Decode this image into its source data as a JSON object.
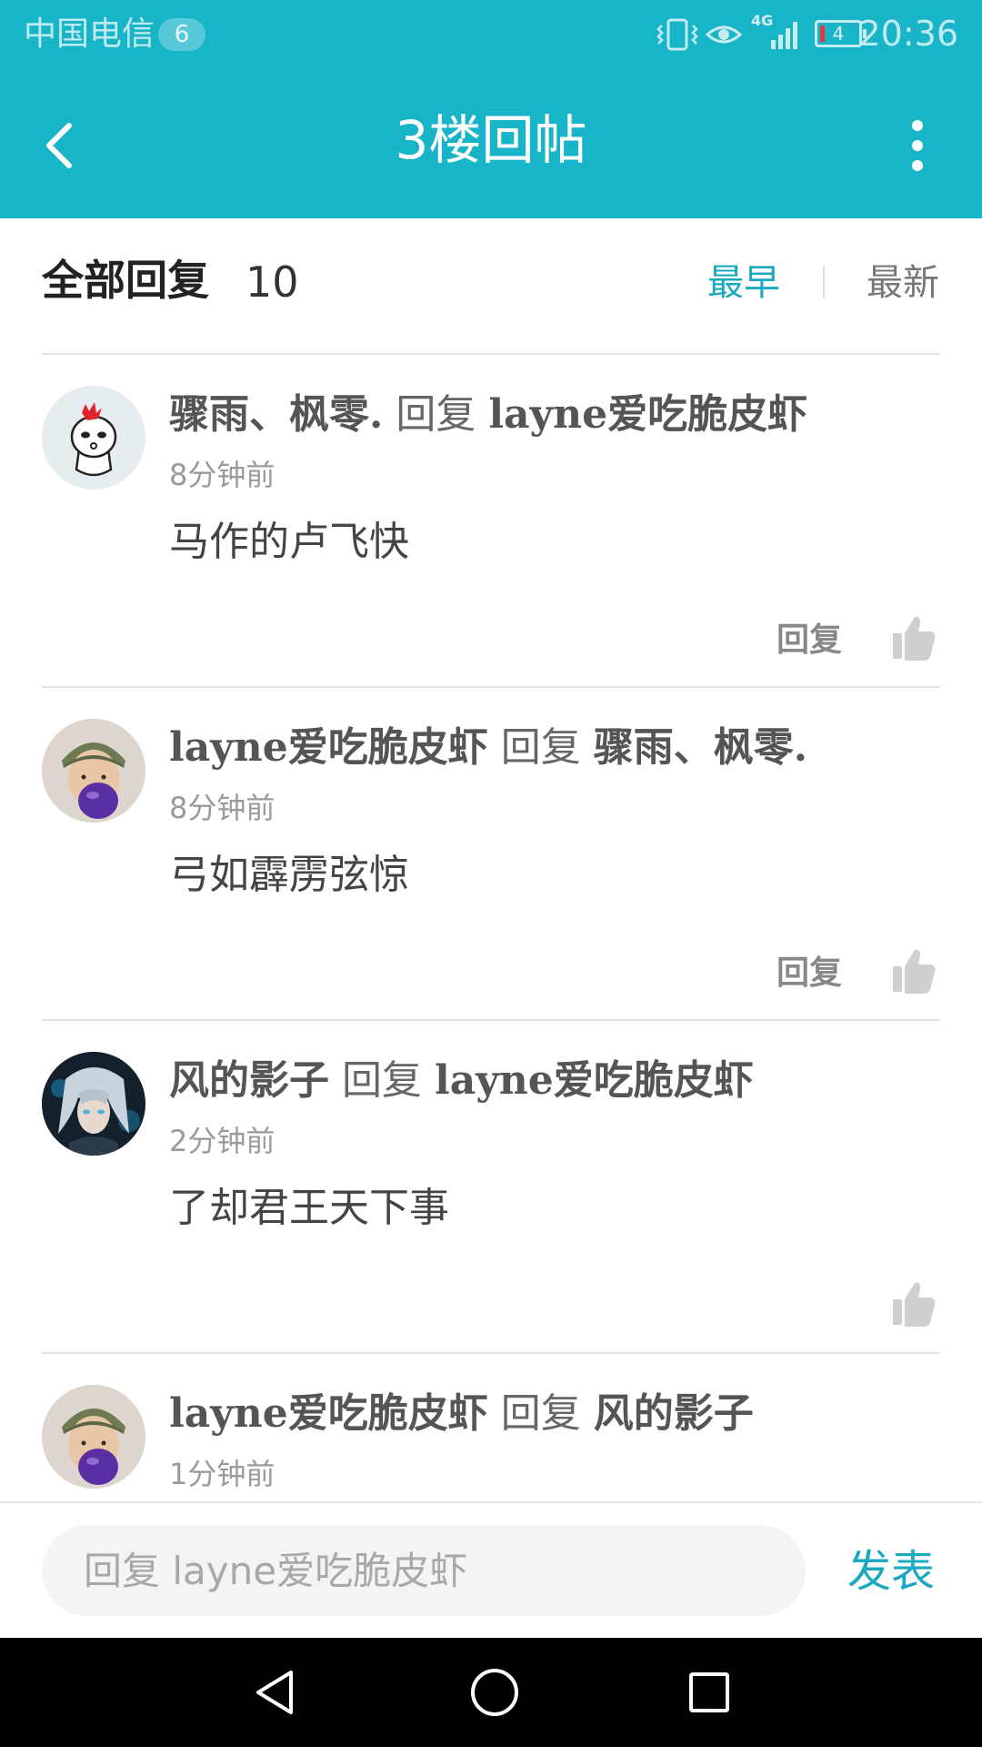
{
  "status_bar": {
    "carrier": "中国电信",
    "sim_badge": "6",
    "network": "4G",
    "battery": "4",
    "time": "20:36"
  },
  "app_bar": {
    "title": "3楼回帖",
    "back_icon": "chevron-left-icon",
    "more_icon": "more-vertical-icon"
  },
  "sort_bar": {
    "title": "全部回复",
    "count": "10",
    "earliest": "最早",
    "newest": "最新",
    "active": "最早",
    "active_color": "#1aa9c0"
  },
  "replies": [
    {
      "author": "骤雨、枫零.",
      "verb": "回复",
      "target": "layne爱吃脆皮虾",
      "time": "8分钟前",
      "text": "马作的卢飞快",
      "action": "回复",
      "avatar": "cartoon-avatar"
    },
    {
      "author": "layne爱吃脆皮虾",
      "verb": "回复",
      "target": "骤雨、枫零.",
      "time": "8分钟前",
      "text": "弓如霹雳弦惊",
      "action": "回复",
      "avatar": "child-avatar"
    },
    {
      "author": "风的影子",
      "verb": "回复",
      "target": "layne爱吃脆皮虾",
      "time": "2分钟前",
      "text": "了却君王天下事",
      "action": "",
      "avatar": "anime-avatar"
    },
    {
      "author": "layne爱吃脆皮虾",
      "verb": "回复",
      "target": "风的影子",
      "time": "1分钟前",
      "text": "",
      "action": "",
      "avatar": "child-avatar"
    }
  ],
  "input_bar": {
    "placeholder": "回复 layne爱吃脆皮虾",
    "send_label": "发表"
  },
  "nav_bar": {
    "icons": [
      "triangle-back-icon",
      "circle-home-icon",
      "square-recents-icon"
    ]
  },
  "colors": {
    "header": "#18b4c8",
    "accent": "#1aa9c0"
  }
}
